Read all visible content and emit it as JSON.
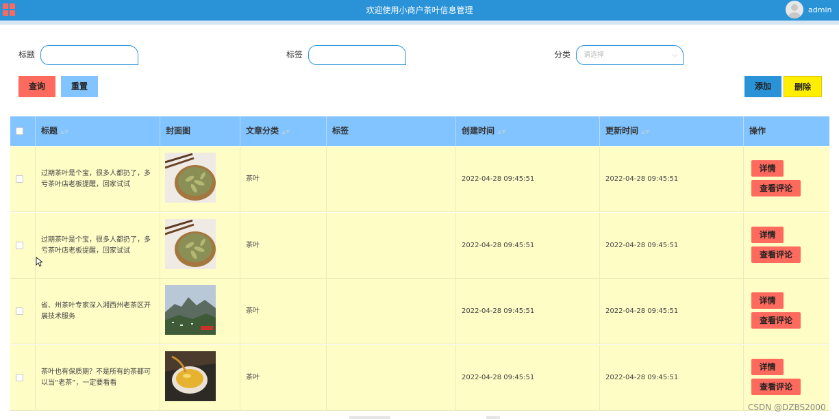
{
  "header": {
    "title": "欢迎使用小商户茶叶信息管理",
    "user": "admin",
    "menu_icon": "grid-icon",
    "avatar_icon": "user-avatar-icon"
  },
  "search": {
    "title_label": "标题",
    "tag_label": "标签",
    "category_label": "分类",
    "category_placeholder": "请选择",
    "query_button": "查询",
    "reset_button": "重置",
    "add_button": "添加",
    "delete_button": "删除"
  },
  "colors": {
    "header_bg": "#2a93d8",
    "table_head_bg": "#82c4ff",
    "row_bg": "#fffdc6",
    "query_btn": "#ff6a5e",
    "reset_btn": "#82c4ff",
    "add_btn": "#2a93d8",
    "delete_btn": "#ffee00",
    "action_btn": "#ff6a5e"
  },
  "table": {
    "columns": [
      "标题",
      "封面图",
      "文章分类",
      "标签",
      "创建时间",
      "更新时间",
      "操作"
    ],
    "detail_label": "详情",
    "comment_label": "查看评论",
    "rows": [
      {
        "title": "过期茶叶是个宝，很多人都扔了，多亏茶叶店老板提醒，回家试试",
        "category": "茶叶",
        "tag": "",
        "created": "2022-04-28 09:45:51",
        "updated": "2022-04-28 09:45:51",
        "cover": "tea-leaves-bowl"
      },
      {
        "title": "过期茶叶是个宝，很多人都扔了，多亏茶叶店老板提醒，回家试试",
        "category": "茶叶",
        "tag": "",
        "created": "2022-04-28 09:45:51",
        "updated": "2022-04-28 09:45:51",
        "cover": "tea-leaves-bowl"
      },
      {
        "title": "省、州茶叶专家深入湘西州老茶区开展技术服务",
        "category": "茶叶",
        "tag": "",
        "created": "2022-04-28 09:45:51",
        "updated": "2022-04-28 09:45:51",
        "cover": "mountain-landscape"
      },
      {
        "title": "茶叶也有保质期？不是所有的茶都可以当“老茶”，一定要看看",
        "category": "茶叶",
        "tag": "",
        "created": "2022-04-28 09:45:51",
        "updated": "2022-04-28 09:45:51",
        "cover": "tea-cup"
      }
    ]
  },
  "watermark": "CSDN @DZBS2000"
}
